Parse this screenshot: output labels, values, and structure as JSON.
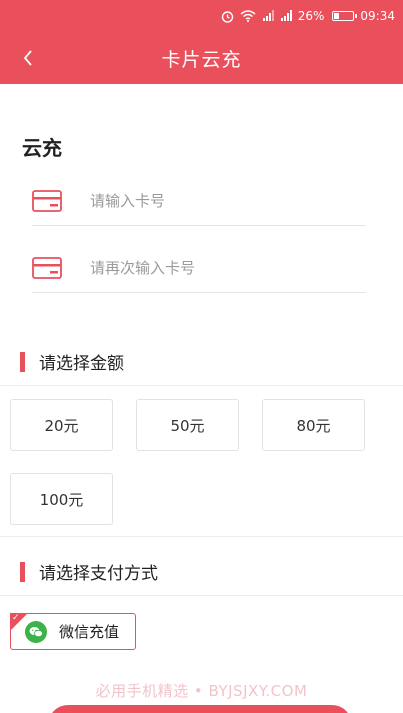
{
  "status_bar": {
    "battery": "26%",
    "battery_level": 0.26,
    "time": "09:34",
    "icons": [
      "alarm-icon",
      "wifi-icon",
      "signal-icon",
      "signal-icon",
      "battery-icon"
    ]
  },
  "header": {
    "title": "卡片云充",
    "back_icon": "chevron-left-icon"
  },
  "section": {
    "title": "云充"
  },
  "card_input": {
    "value": "",
    "placeholder": "请输入卡号",
    "icon": "card-icon"
  },
  "card_confirm": {
    "value": "",
    "placeholder": "请再次输入卡号",
    "icon": "card-icon"
  },
  "amount_section": {
    "title": "请选择金额",
    "options": [
      "20元",
      "50元",
      "80元",
      "100元"
    ]
  },
  "payment_section": {
    "title": "请选择支付方式",
    "methods": [
      {
        "label": "微信充值",
        "icon": "wechat-icon",
        "selected": true
      }
    ]
  },
  "watermark": "必用手机精选 • BYJSJXY.COM",
  "colors": {
    "brand": "#e9505c",
    "wechat": "#3cb34a"
  }
}
